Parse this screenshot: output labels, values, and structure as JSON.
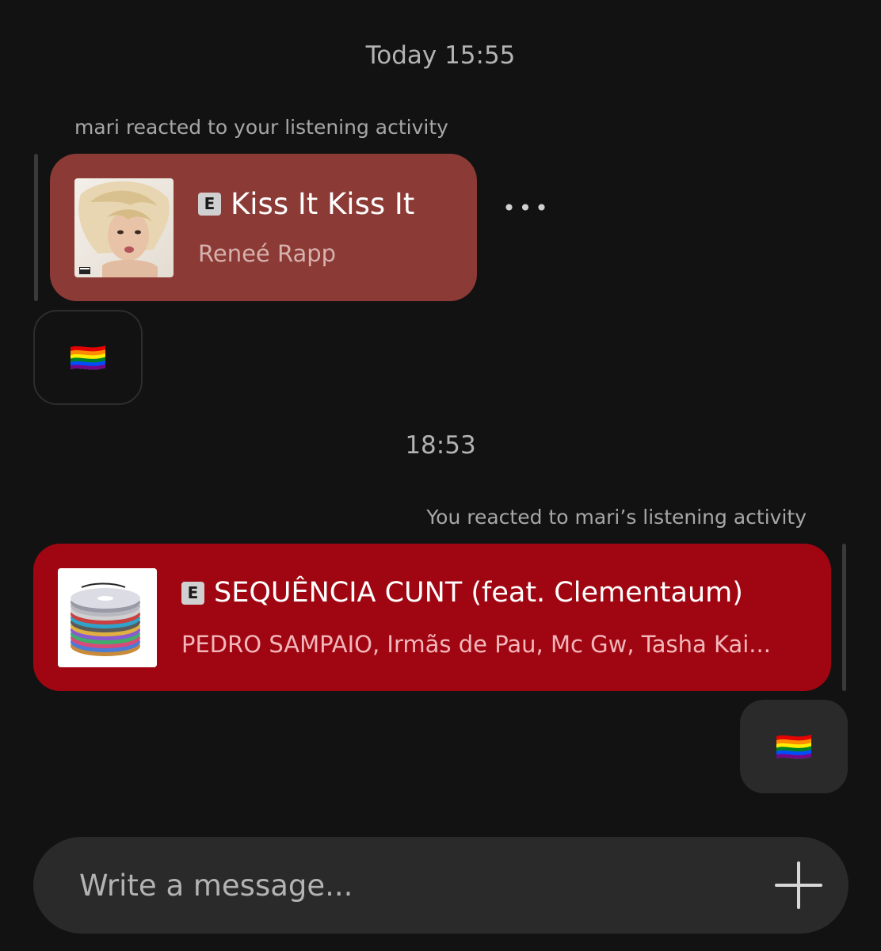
{
  "timestamps": [
    "Today 15:55",
    "18:53"
  ],
  "messages": [
    {
      "caption": "mari reacted to your listening activity",
      "track": {
        "explicit_label": "E",
        "title": "Kiss It Kiss It",
        "artist": "Reneé Rapp"
      },
      "reaction": "🏳️‍🌈",
      "more_label": "•••"
    },
    {
      "caption": "You reacted to mari’s listening activity",
      "track": {
        "explicit_label": "E",
        "title": "SEQUÊNCIA CUNT (feat. Clementaum)",
        "artist": "PEDRO SAMPAIO, Irmãs de Pau, Mc Gw, Tasha Kai..."
      },
      "reaction": "🏳️‍🌈"
    }
  ],
  "composer": {
    "placeholder": "Write a message...",
    "add_icon": "plus-icon"
  },
  "colors": {
    "background": "#121212",
    "card_1": "#8c3a35",
    "card_2": "#a00611",
    "reaction_bubble": "#2a2a2a",
    "composer": "#2a2a2a"
  }
}
